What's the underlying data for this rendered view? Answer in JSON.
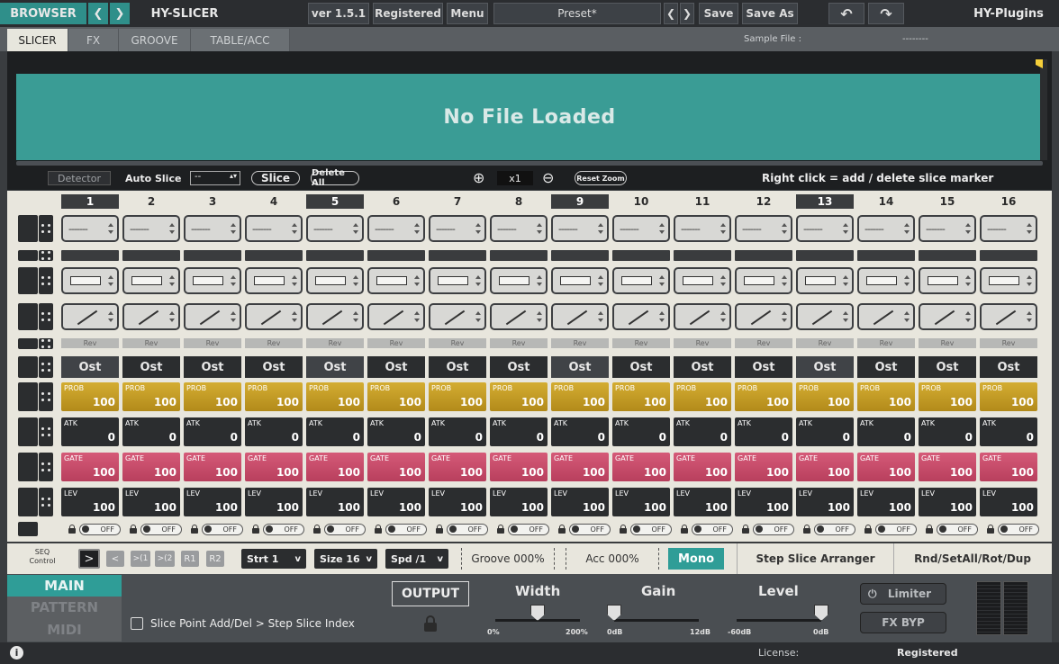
{
  "topbar": {
    "browser": "BROWSER",
    "app_name": "HY-SLICER",
    "version": "ver 1.5.1",
    "registered": "Registered",
    "menu": "Menu",
    "preset": "Preset*",
    "save": "Save",
    "save_as": "Save As",
    "brand": "HY-Plugins"
  },
  "tabs": [
    "SLICER",
    "FX",
    "GROOVE",
    "TABLE/ACC"
  ],
  "sample": {
    "label": "Sample File :",
    "value": "--------"
  },
  "waveform": {
    "message": "No File Loaded"
  },
  "wave_tools": {
    "detector": "Detector",
    "auto_slice": "Auto Slice",
    "auto_value": "--",
    "slice": "Slice",
    "delete_all": "Delete All",
    "zoom": "x1",
    "reset_zoom": "Reset Zoom",
    "hint": "Right click = add / delete slice marker"
  },
  "steps": {
    "numbers": [
      "1",
      "2",
      "3",
      "4",
      "5",
      "6",
      "7",
      "8",
      "9",
      "10",
      "11",
      "12",
      "13",
      "14",
      "15",
      "16"
    ],
    "highlighted": [
      1,
      5,
      9,
      13
    ],
    "dash": "-------",
    "rev": "Rev",
    "ost": "Ost",
    "prob_label": "PROB",
    "prob_value": "100",
    "atk_label": "ATK",
    "atk_value": "0",
    "gate_label": "GATE",
    "gate_value": "100",
    "lev_label": "LEV",
    "lev_value": "100",
    "off": "OFF"
  },
  "seq": {
    "label": "SEQ\nControl",
    "nav": [
      ">",
      "<",
      ">(1",
      ">(2",
      "R1",
      "R2"
    ],
    "start": "Strt 1",
    "size": "Size 16",
    "speed": "Spd /1",
    "groove": "Groove 000%",
    "acc": "Acc 000%",
    "mono": "Mono",
    "arranger": "Step Slice Arranger",
    "rnd": "Rnd/SetAll/Rot/Dup"
  },
  "bottom": {
    "main": "MAIN",
    "pattern": "PATTERN",
    "midi": "MIDI",
    "checkbox_label": "Slice Point Add/Del > Step Slice Index",
    "output": "OUTPUT",
    "width": {
      "label": "Width",
      "min": "0%",
      "max": "200%",
      "value_pct": 50
    },
    "gain": {
      "label": "Gain",
      "min": "0dB",
      "max": "12dB",
      "value_pct": 0
    },
    "level": {
      "label": "Level",
      "min": "-60dB",
      "max": "0dB",
      "value_pct": 100
    },
    "limiter": "Limiter",
    "fx_byp": "FX BYP"
  },
  "footer": {
    "license_label": "License:",
    "license_value": "Registered"
  },
  "colors": {
    "accent": "#3a9c95",
    "prob": "#c99f28",
    "gate": "#c94b69"
  }
}
